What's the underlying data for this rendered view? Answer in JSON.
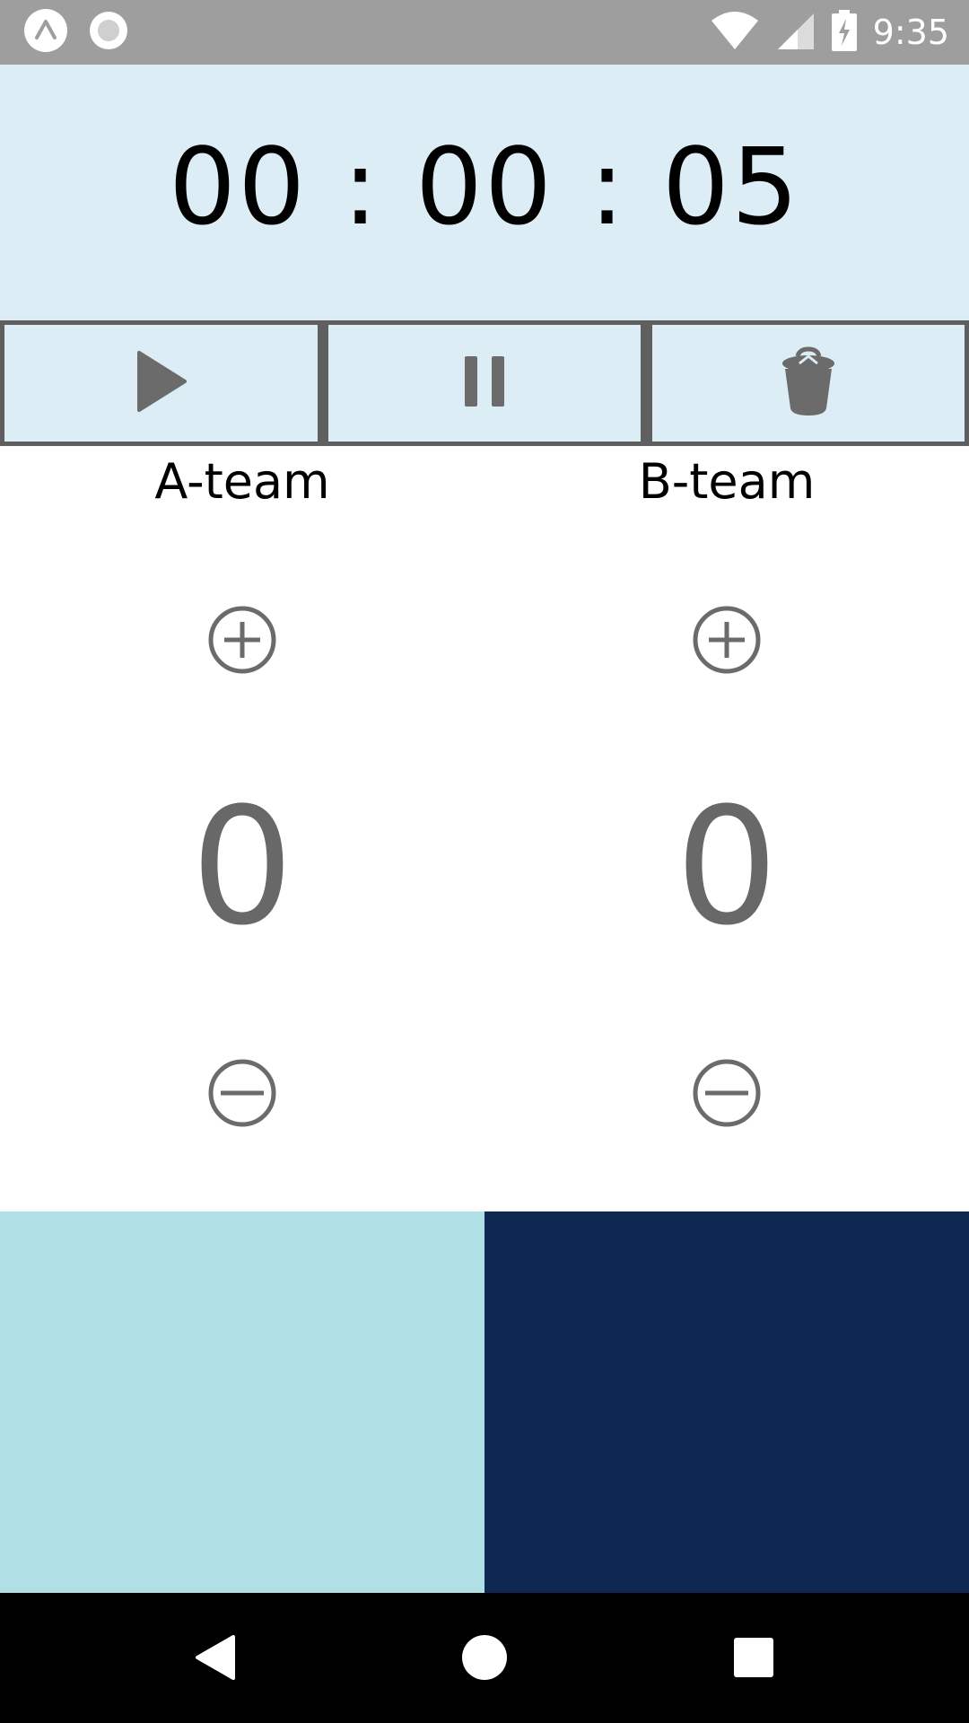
{
  "status_bar": {
    "time": "9:35",
    "icons": [
      "app-launcher-icon",
      "record-icon",
      "wifi-icon",
      "cell-signal-icon",
      "battery-charging-icon"
    ]
  },
  "timer": {
    "display": "00 : 00 : 05"
  },
  "controls": {
    "buttons": [
      {
        "icon": "play-icon"
      },
      {
        "icon": "pause-icon"
      },
      {
        "icon": "trash-icon"
      }
    ],
    "color": "#6b6b6b"
  },
  "teams": [
    {
      "name": "A-team",
      "score": "0",
      "color": "#b0dfe5"
    },
    {
      "name": "B-team",
      "score": "0",
      "color": "#0f2851"
    }
  ],
  "colors": {
    "timer_bg": "#dcedf5",
    "status_bar": "#9e9e9e",
    "icon_gray": "#6b6b6b"
  }
}
